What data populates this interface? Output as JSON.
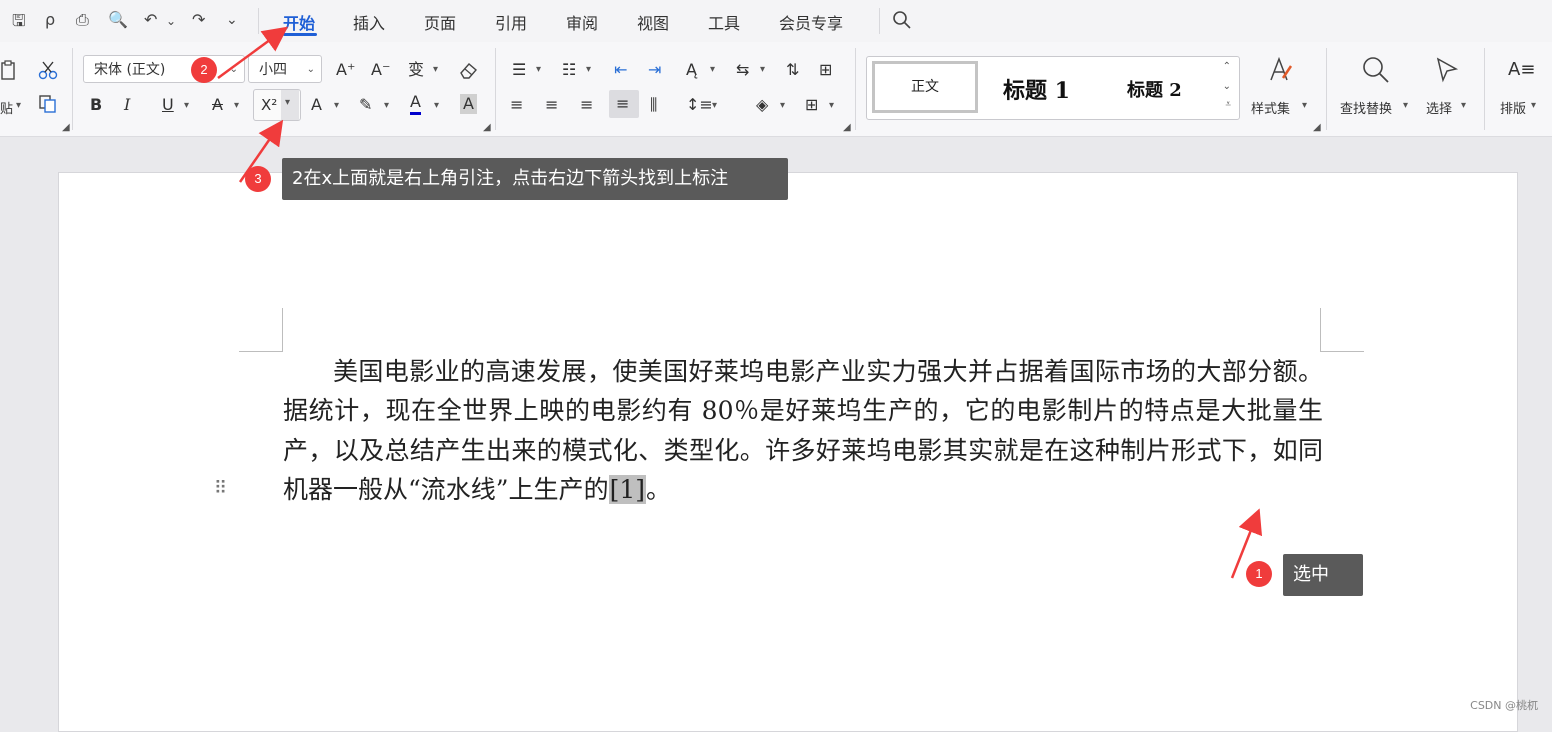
{
  "quick_access": {
    "save": "🖫",
    "format_painter": "ρ",
    "print": "⎙",
    "print_preview": "🔍",
    "undo": "↶",
    "undo_caret": "⌄",
    "redo": "↷",
    "more": "⌄"
  },
  "menu_tabs": [
    "开始",
    "插入",
    "页面",
    "引用",
    "审阅",
    "视图",
    "工具",
    "会员专享"
  ],
  "font": {
    "name": "宋体 (正文)",
    "size": "小四"
  },
  "paste_label": "贴",
  "styles": {
    "normal": "正文",
    "heading1": "标题 1",
    "heading2": "标题 2",
    "styles_set": "样式集"
  },
  "right_tools": {
    "find_replace": "查找替换",
    "select": "选择",
    "layout": "排版"
  },
  "document": {
    "paragraph_before": "美国电影业的高速发展，使美国好莱坞电影产业实力强大并占据着国际市场的大部分额。据统计，现在全世界上映的电影约有 80％是好莱坞生产的，它的电影制片的特点是大批量生产，以及总结产生出来的模式化、类型化。许多好莱坞电影其实就是在这种制片形式下，如同机器一般从“流水线”上生产的",
    "citation": "[1]",
    "paragraph_after": "。"
  },
  "annotations": {
    "badge1": "1",
    "callout1": "选中",
    "badge2": "2",
    "badge3": "3",
    "callout3": "2在x上面就是右上角引注，点击右边下箭头找到上标注",
    "arrow_color": "#f03c3c"
  },
  "watermark": "CSDN @桃杌",
  "icons": {
    "bold": "B",
    "italic": "I",
    "underline": "U",
    "strikethrough": "A",
    "superscript": "X²",
    "font_color": "A",
    "char_shading": "A",
    "grow_font": "A⁺",
    "shrink_font": "A⁻",
    "phonetic": "变",
    "clear_format": "⌫"
  }
}
